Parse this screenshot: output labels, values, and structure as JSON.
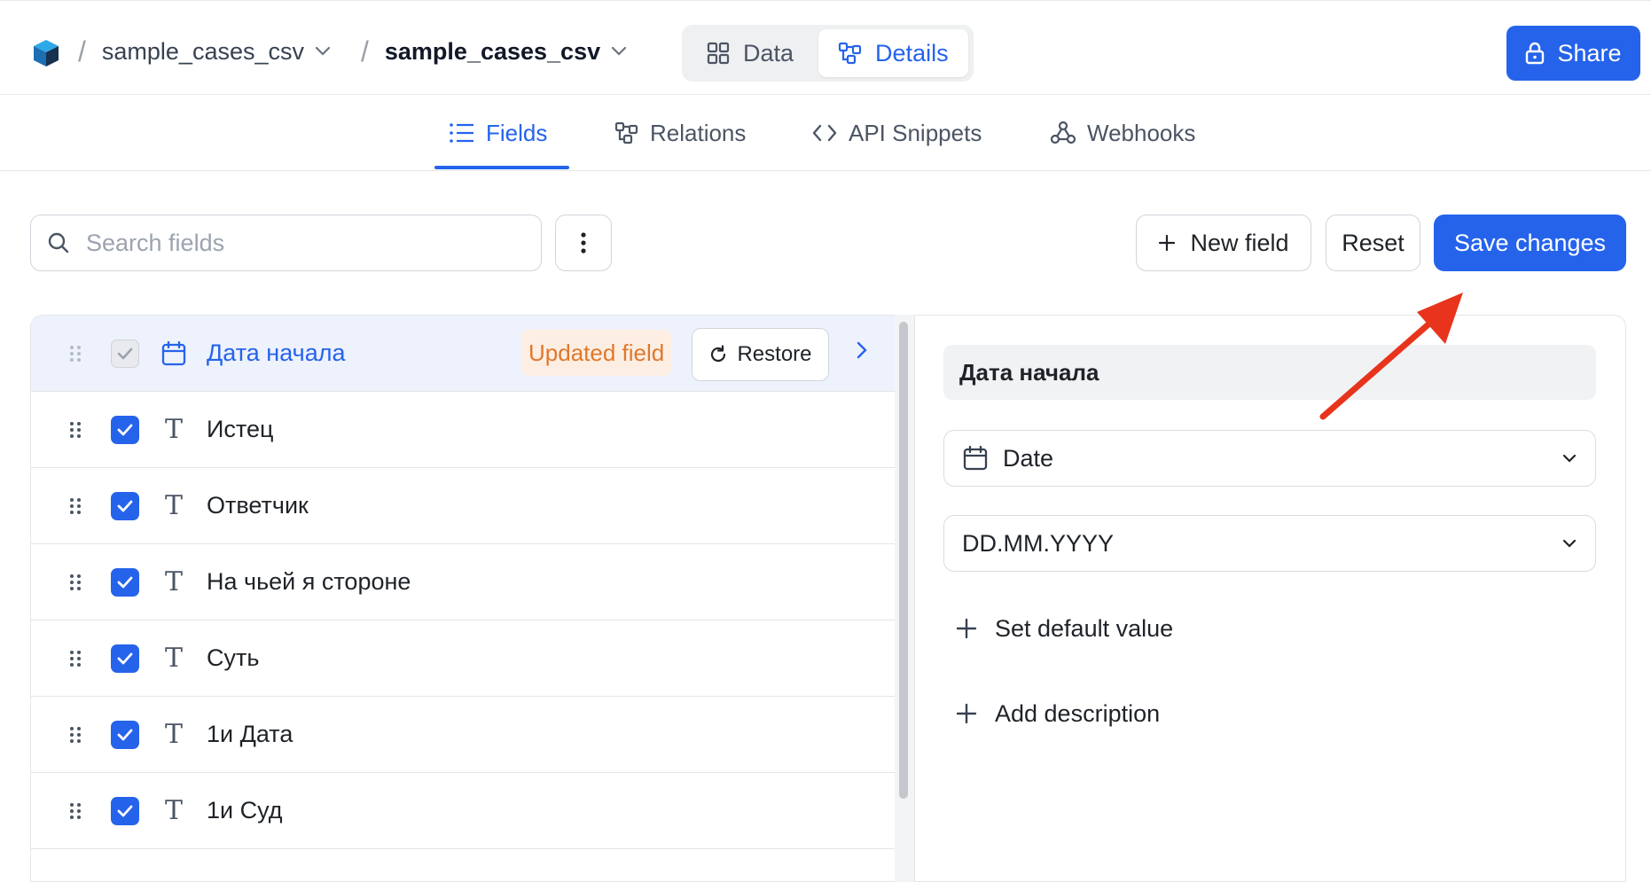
{
  "header": {
    "breadcrumb": [
      {
        "label": "sample_cases_csv"
      },
      {
        "label": "sample_cases_csv"
      }
    ],
    "separator": "/",
    "view_toggle": [
      {
        "label": "Data",
        "icon": "grid-icon"
      },
      {
        "label": "Details",
        "icon": "schema-icon",
        "active": true
      }
    ],
    "share_label": "Share"
  },
  "tabs": [
    {
      "label": "Fields",
      "icon": "list-icon",
      "active": true
    },
    {
      "label": "Relations",
      "icon": "relations-icon"
    },
    {
      "label": "API Snippets",
      "icon": "code-icon"
    },
    {
      "label": "Webhooks",
      "icon": "webhook-icon"
    }
  ],
  "toolbar": {
    "search_placeholder": "Search fields",
    "new_field_label": "New field",
    "reset_label": "Reset",
    "save_label": "Save changes"
  },
  "fields": [
    {
      "name": "Дата начала",
      "type_icon": "calendar-icon",
      "checked": true,
      "disabled": true,
      "selected": true,
      "badge": "Updated field",
      "restore_label": "Restore"
    },
    {
      "name": "Истец",
      "type_icon": "text-type-icon",
      "checked": true
    },
    {
      "name": "Ответчик",
      "type_icon": "text-type-icon",
      "checked": true
    },
    {
      "name": "На чьей я стороне",
      "type_icon": "text-type-icon",
      "checked": true
    },
    {
      "name": "Суть",
      "type_icon": "text-type-icon",
      "checked": true
    },
    {
      "name": "1и Дата",
      "type_icon": "text-type-icon",
      "checked": true
    },
    {
      "name": "1и Суд",
      "type_icon": "text-type-icon",
      "checked": true
    }
  ],
  "detail": {
    "field_name": "Дата начала",
    "type_select": {
      "value": "Date",
      "icon": "calendar-icon"
    },
    "format_select": {
      "value": "DD.MM.YYYY"
    },
    "set_default_label": "Set default value",
    "add_description_label": "Add description"
  },
  "colors": {
    "accent": "#2563eb",
    "badge_bg": "#fdeee3",
    "badge_text": "#e0782b",
    "annotation_arrow": "#e8341c"
  }
}
